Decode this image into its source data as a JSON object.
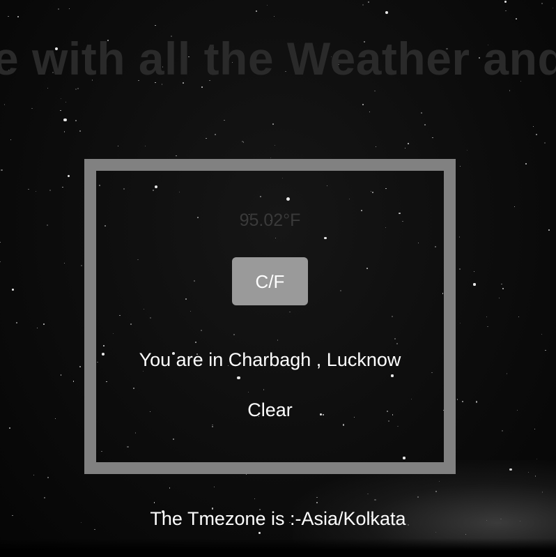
{
  "banner": {
    "text": "e with all the Weather and"
  },
  "card": {
    "temperature": "95.02°F",
    "unit_toggle_label": "C/F",
    "location_text": "You are in Charbagh , Lucknow",
    "condition": "Clear"
  },
  "footer": {
    "timezone_text": "The Tmezone is :-Asia/Kolkata"
  },
  "colors": {
    "background": "#0b0b0b",
    "card_border": "#818181",
    "button": "#9a9a9a",
    "text": "#ffffff"
  }
}
